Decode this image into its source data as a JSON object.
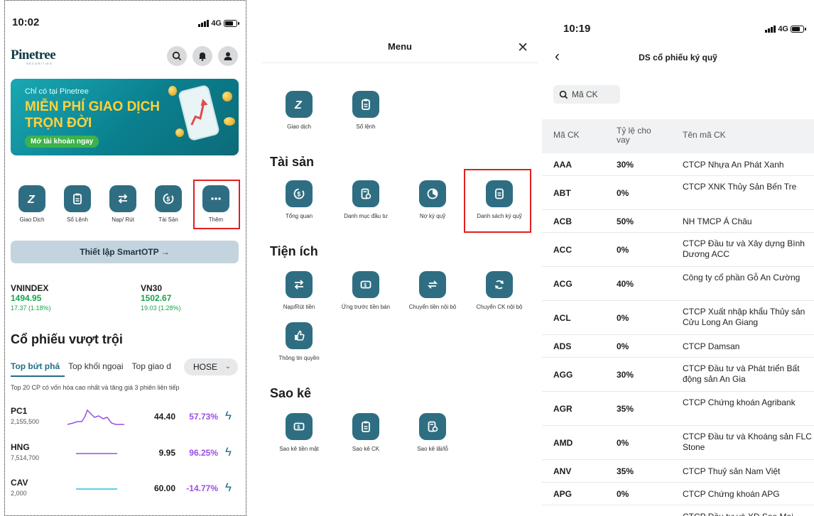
{
  "left": {
    "status": {
      "time": "10:02",
      "network": "4G"
    },
    "logo": {
      "name": "Pinetree",
      "sub": "SECURITIES"
    },
    "banner": {
      "line1": "Chỉ có tại Pinetree",
      "line2": "MIỄN PHÍ GIAO DỊCH",
      "line3": "TRỌN ĐỜI",
      "cta": "Mở tài khoản ngay"
    },
    "actions": [
      {
        "label": "Giao Dịch",
        "icon": "trade-icon"
      },
      {
        "label": "Sổ Lệnh",
        "icon": "order-book-icon"
      },
      {
        "label": "Nạp/ Rút",
        "icon": "transfer-icon"
      },
      {
        "label": "Tài Sản",
        "icon": "asset-icon"
      },
      {
        "label": "Thêm",
        "icon": "more-icon"
      }
    ],
    "otp_label": "Thiết lập SmartOTP →",
    "indices": [
      {
        "name": "VNINDEX",
        "value": "1494.95",
        "change": "17.37 (1.18%)"
      },
      {
        "name": "VN30",
        "value": "1502.67",
        "change": "19.03 (1.28%)"
      }
    ],
    "section_title": "Cổ phiếu vượt trội",
    "tabs": [
      "Top bứt phá",
      "Top khối ngoại",
      "Top giao d"
    ],
    "exchange": "HOSE",
    "note": "Top 20 CP có vốn hóa cao nhất và tăng giá 3 phiên liên tiếp",
    "stocks": [
      {
        "symbol": "PC1",
        "volume": "2,155,500",
        "price": "44.40",
        "pct": "57.73%",
        "color": "#9b4de8"
      },
      {
        "symbol": "HNG",
        "volume": "7,514,700",
        "price": "9.95",
        "pct": "96.25%",
        "color": "#9b4de8"
      },
      {
        "symbol": "CAV",
        "volume": "2,000",
        "price": "60.00",
        "pct": "-14.77%",
        "color": "#1fc6d8"
      }
    ]
  },
  "menu": {
    "title": "Menu",
    "top_items": [
      {
        "label": "Giao dịch"
      },
      {
        "label": "Sổ lệnh"
      }
    ],
    "sections": [
      {
        "title": "Tài sản",
        "items": [
          {
            "label": "Tổng quan"
          },
          {
            "label": "Danh mục đầu tư"
          },
          {
            "label": "Nợ ký quỹ"
          },
          {
            "label": "Danh sách ký quỹ"
          }
        ]
      },
      {
        "title": "Tiện ích",
        "items": [
          {
            "label": "Nạp/Rút tiền"
          },
          {
            "label": "Ứng trước tiền bán"
          },
          {
            "label": "Chuyển tiền nội bộ"
          },
          {
            "label": "Chuyển CK nội bộ"
          },
          {
            "label": "Thông tin quyền"
          }
        ]
      },
      {
        "title": "Sao kê",
        "items": [
          {
            "label": "Sao kê tiền mặt"
          },
          {
            "label": "Sao kê CK"
          },
          {
            "label": "Sao kê lãi/lỗ"
          }
        ]
      }
    ]
  },
  "right": {
    "status": {
      "time": "10:19",
      "network": "4G"
    },
    "title": "DS cổ phiếu ký quỹ",
    "search_placeholder": "Mã CK",
    "headers": [
      "Mã CK",
      "Tỷ lệ cho vay",
      "Tên mã CK"
    ],
    "rows": [
      {
        "code": "AAA",
        "ratio": "30%",
        "name": "CTCP Nhựa An Phát Xanh"
      },
      {
        "code": "ABT",
        "ratio": "0%",
        "name": "CTCP XNK Thủy Sản Bến Tre"
      },
      {
        "code": "ACB",
        "ratio": "50%",
        "name": "NH TMCP Á Châu"
      },
      {
        "code": "ACC",
        "ratio": "0%",
        "name": "CTCP Đầu tư và Xây dựng Bình Dương ACC"
      },
      {
        "code": "ACG",
        "ratio": "40%",
        "name": "Công ty cổ phần Gỗ An Cường"
      },
      {
        "code": "ACL",
        "ratio": "0%",
        "name": "CTCP Xuất nhập khẩu Thủy sản Cửu Long An Giang"
      },
      {
        "code": "ADS",
        "ratio": "0%",
        "name": "CTCP Damsan"
      },
      {
        "code": "AGG",
        "ratio": "30%",
        "name": "CTCP Đầu tư và Phát triển Bất động sản An Gia"
      },
      {
        "code": "AGR",
        "ratio": "35%",
        "name": "CTCP Chứng khoán Agribank"
      },
      {
        "code": "AMD",
        "ratio": "0%",
        "name": "CTCP Đầu tư và Khoáng sản FLC Stone"
      },
      {
        "code": "ANV",
        "ratio": "35%",
        "name": "CTCP Thuỷ sản Nam Việt"
      },
      {
        "code": "APG",
        "ratio": "0%",
        "name": "CTCP Chứng khoán APG"
      },
      {
        "code": "",
        "ratio": "",
        "name": "CTCP Đầu tư và XD Sao Mai"
      }
    ]
  }
}
